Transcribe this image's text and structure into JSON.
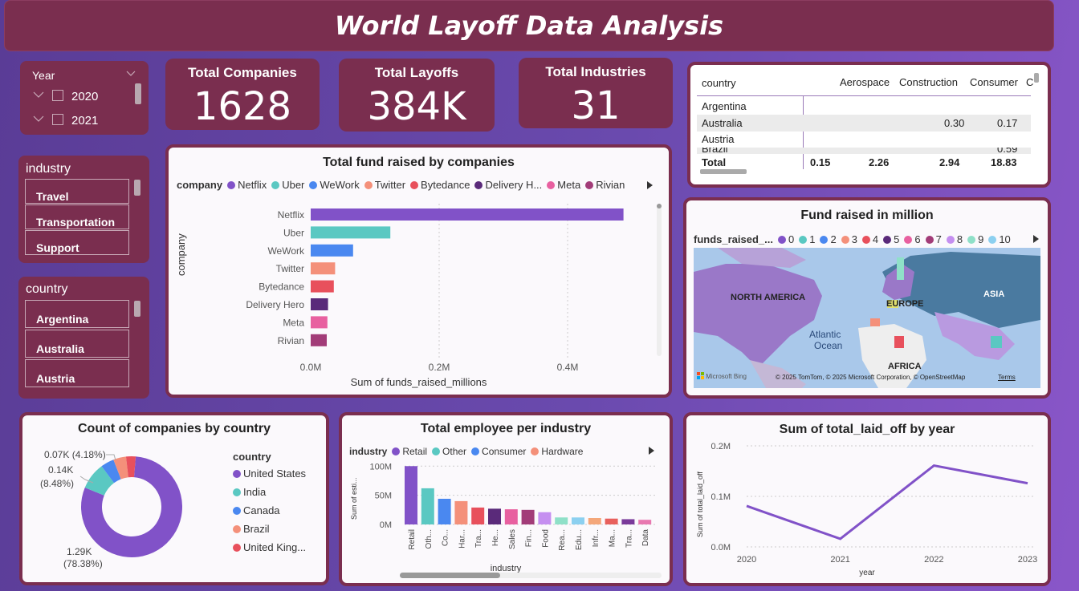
{
  "title": "World Layoff Data Analysis",
  "slicers": {
    "year": {
      "label": "Year",
      "items": [
        "2020",
        "2021"
      ]
    },
    "industry": {
      "label": "industry",
      "items": [
        "Travel",
        "Transportation",
        "Support"
      ]
    },
    "country": {
      "label": "country",
      "items": [
        "Argentina",
        "Australia",
        "Austria"
      ]
    }
  },
  "kpis": [
    {
      "label": "Total Companies",
      "value": "1628"
    },
    {
      "label": "Total Layoffs",
      "value": "384K"
    },
    {
      "label": "Total Industries",
      "value": "31"
    }
  ],
  "matrix": {
    "headers": [
      "country",
      "Aerospace",
      "Construction",
      "Consumer",
      "C"
    ],
    "rows": [
      [
        "Argentina",
        "",
        "",
        ""
      ],
      [
        "Australia",
        "",
        "0.30",
        "0.17"
      ],
      [
        "Austria",
        "",
        "",
        ""
      ],
      [
        "Brazil",
        "",
        "",
        "0.59"
      ]
    ],
    "total": [
      "Total",
      "0.15",
      "2.26",
      "2.94",
      "18.83"
    ]
  },
  "fund_chart": {
    "title": "Total fund raised by companies",
    "legend_title": "company",
    "xlabel": "Sum of funds_raised_millions",
    "ylabel": "company",
    "ticks": [
      "0.0M",
      "0.2M",
      "0.4M"
    ],
    "colors": [
      "#8152c8",
      "#5ac8c2",
      "#4a88f0",
      "#f4907a",
      "#e8505c",
      "#5a2a7a",
      "#e860a0",
      "#a23c78"
    ]
  },
  "map": {
    "title": "Fund raised in million",
    "legend_title": "funds_raised_...",
    "legend_items": [
      "0",
      "1",
      "2",
      "3",
      "4",
      "5",
      "6",
      "7",
      "8",
      "9",
      "10"
    ],
    "legend_colors": [
      "#8152c8",
      "#5ac8c2",
      "#4a88f0",
      "#f4907a",
      "#e8505c",
      "#5a2a7a",
      "#e860a0",
      "#a23c78",
      "#c58ff0",
      "#8fe0c8",
      "#8cd0f0"
    ],
    "labels": {
      "na": "NORTH AMERICA",
      "eu": "EUROPE",
      "asia": "ASIA",
      "africa": "AFRICA",
      "ocean1": "Atlantic",
      "ocean2": "Ocean"
    },
    "brand": "Microsoft Bing",
    "credits": "© 2025 TomTom, © 2025 Microsoft Corporation, © OpenStreetMap",
    "terms": "Terms"
  },
  "chart_data": [
    {
      "type": "bar",
      "title": "Total fund raised by companies",
      "categories": [
        "Netflix",
        "Uber",
        "WeWork",
        "Twitter",
        "Bytedance",
        "Delivery Hero",
        "Meta",
        "Rivian"
      ],
      "legend_labels": [
        "Netflix",
        "Uber",
        "WeWork",
        "Twitter",
        "Bytedance",
        "Delivery H...",
        "Meta",
        "Rivian"
      ],
      "values": [
        487,
        124,
        66,
        38,
        36,
        27,
        26,
        25
      ],
      "xlabel": "Sum of funds_raised_millions",
      "ylabel": "company",
      "xlim": [
        0,
        500
      ]
    },
    {
      "type": "pie",
      "title": "Count of companies by country",
      "legend_title": "country",
      "categories": [
        "United States",
        "India",
        "Canada",
        "Brazil",
        "United King..."
      ],
      "values": [
        78.38,
        8.48,
        4.18,
        4.0,
        3.0
      ],
      "colors": [
        "#8152c8",
        "#5ac8c2",
        "#4a88f0",
        "#f4907a",
        "#e8505c"
      ],
      "data_labels": [
        {
          "l1": "1.29K",
          "l2": "(78.38%)"
        },
        {
          "l1": "0.14K",
          "l2": "(8.48%)"
        },
        {
          "l1": "0.07K (4.18%)",
          "l2": ""
        }
      ]
    },
    {
      "type": "bar",
      "title": "Total employee per industry",
      "legend_title": "industry",
      "legend_labels": [
        "Retail",
        "Other",
        "Consumer",
        "Hardware"
      ],
      "categories": [
        "Retail",
        "Oth...",
        "Co...",
        "Har...",
        "Tra...",
        "He...",
        "Sales",
        "Fin...",
        "Food",
        "Rea...",
        "Edu...",
        "Infr...",
        "Ma...",
        "Tra...",
        "Data"
      ],
      "values": [
        100,
        62,
        44,
        40,
        29,
        27,
        26,
        25,
        21,
        12,
        12,
        11,
        10,
        9,
        8
      ],
      "colors": [
        "#8152c8",
        "#5ac8c2",
        "#4a88f0",
        "#f4907a",
        "#e8505c",
        "#5a2a7a",
        "#e860a0",
        "#a23c78",
        "#c58ff0",
        "#8fe0c8",
        "#8cd0f0",
        "#f4a77a",
        "#e8605c",
        "#7a3a9a",
        "#e878b0"
      ],
      "yticks": [
        "100M",
        "50M",
        "0M"
      ],
      "ylabel": "Sum of esti...",
      "xlabel": "industry",
      "ylim": [
        0,
        110
      ]
    },
    {
      "type": "line",
      "title": "Sum of total_laid_off by year",
      "x": [
        "2020",
        "2021",
        "2022",
        "2023"
      ],
      "values": [
        0.081,
        0.016,
        0.161,
        0.126
      ],
      "yticks": [
        "0.2M",
        "0.1M",
        "0.0M"
      ],
      "ylim": [
        0,
        0.2
      ],
      "xlabel": "year",
      "ylabel": "Sum of total_laid_off"
    }
  ]
}
